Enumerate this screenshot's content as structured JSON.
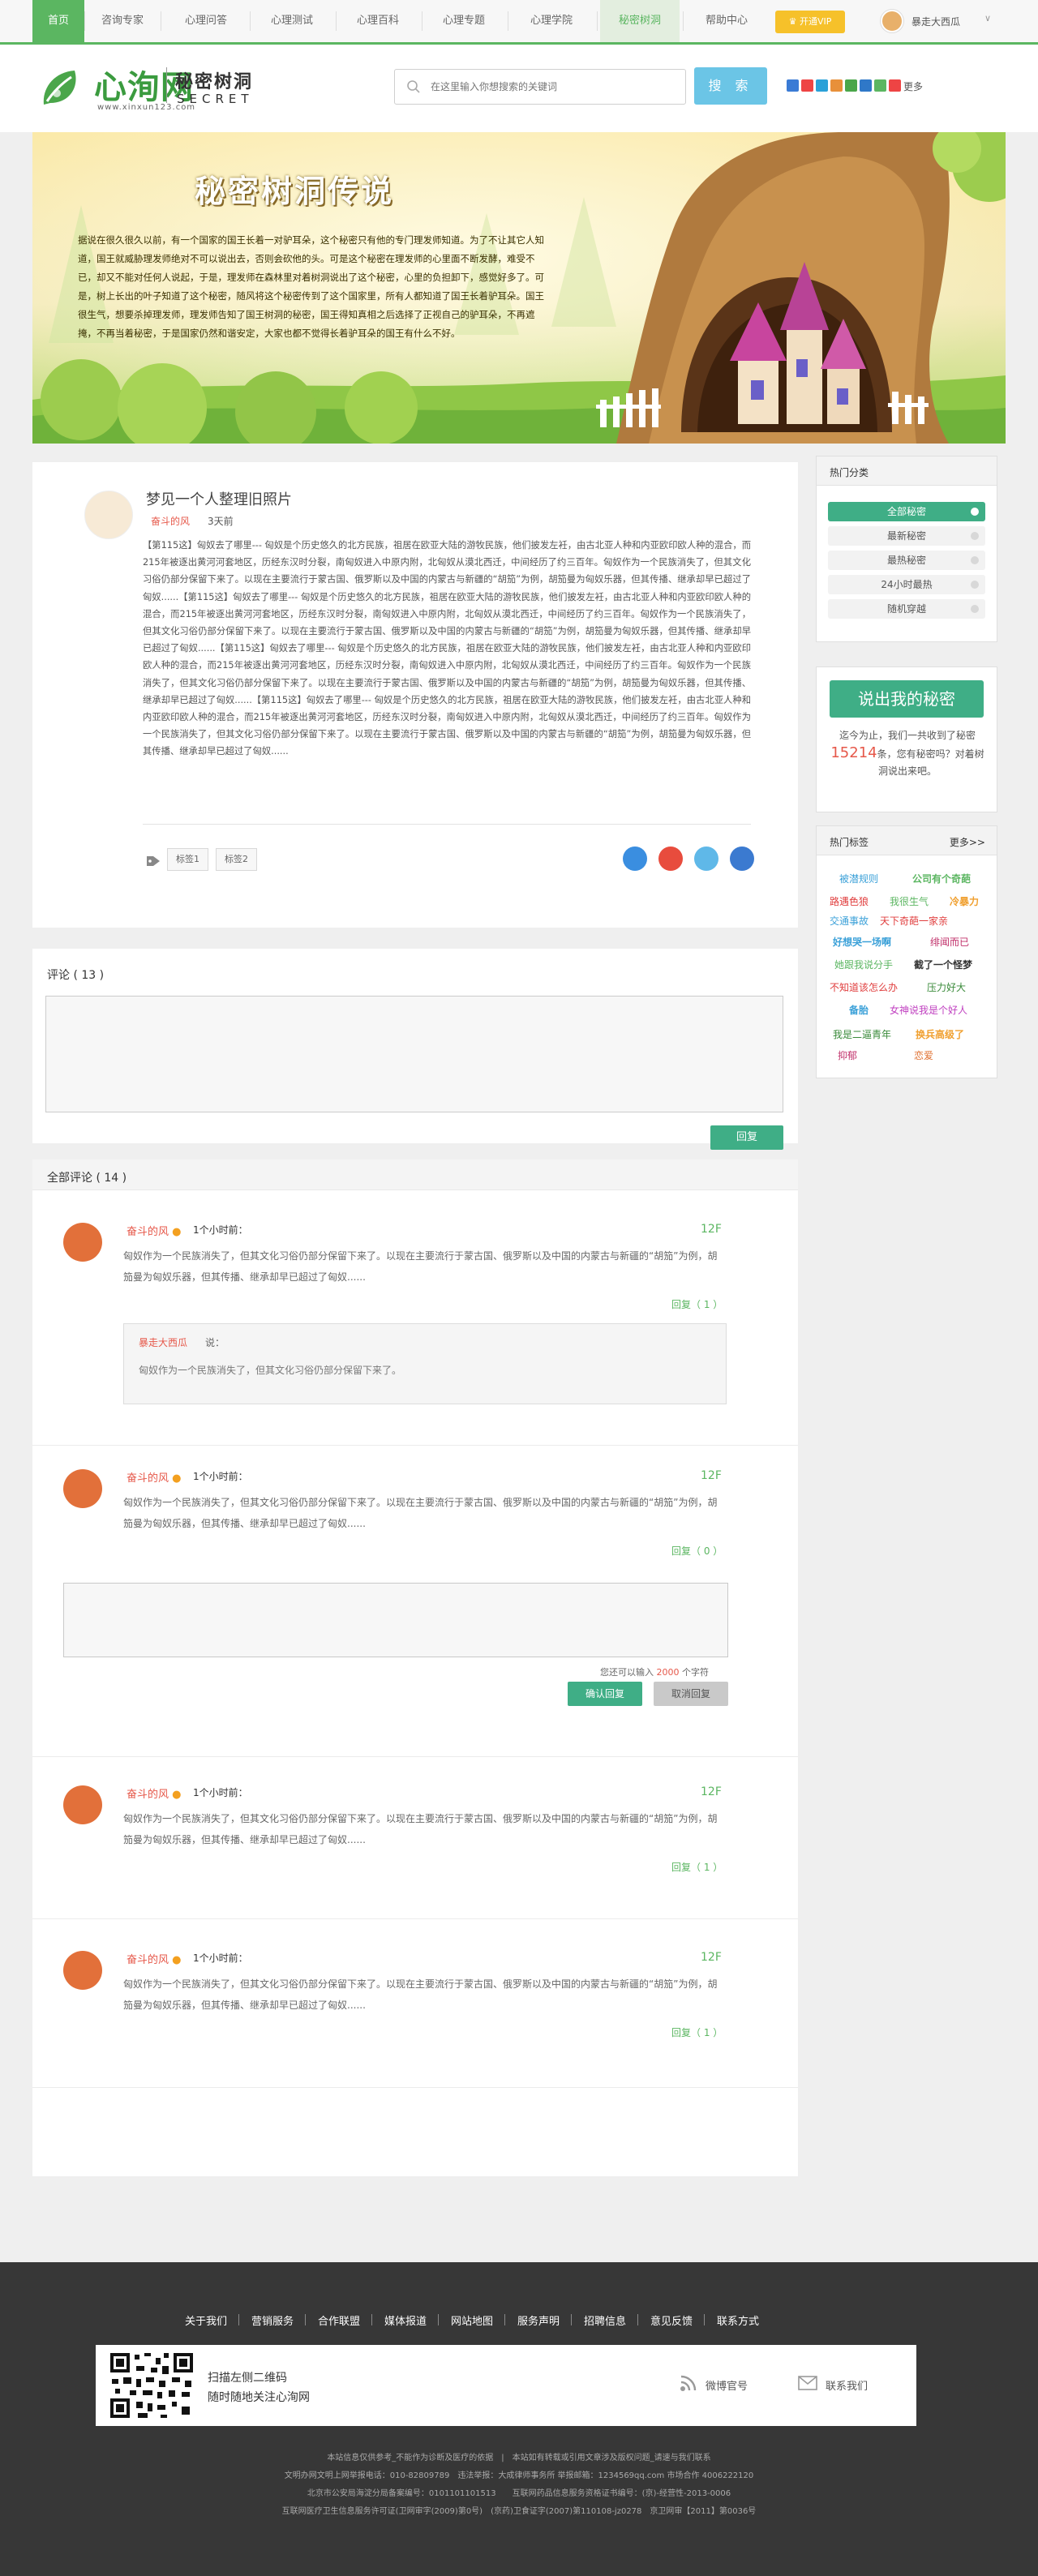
{
  "nav": {
    "items": [
      {
        "label": "首页"
      },
      {
        "label": "咨询专家"
      },
      {
        "label": "心理问答"
      },
      {
        "label": "心理测试"
      },
      {
        "label": "心理百科"
      },
      {
        "label": "心理专题"
      },
      {
        "label": "心理学院"
      },
      {
        "label": "秘密树洞"
      },
      {
        "label": "帮助中心"
      }
    ],
    "open_btn": "开通VIP",
    "user_name": "暴走大西瓜",
    "user_caret": "∨"
  },
  "header": {
    "logo_name": "心洵网",
    "logo_url": "www.xinxun123.com",
    "logo_sub_cn": "秘密树洞",
    "logo_sub_en": "SECRET",
    "search_placeholder": "在这里输入你想搜索的关键词",
    "search_btn": "搜 索",
    "share_more": "更多"
  },
  "banner": {
    "title": "秘密树洞传说",
    "text": "据说在很久很久以前，有一个国家的国王长着一对驴耳朵，这个秘密只有他的专门理发师知道。为了不让其它人知道，国王就威胁理发师绝对不可以说出去，否则会砍他的头。可是这个秘密在理发师的心里面不断发酵，难受不已，却又不能对任何人说起，于是，理发师在森林里对着树洞说出了这个秘密，心里的负担卸下，感觉好多了。可是，树上长出的叶子知道了这个秘密，随风将这个秘密传到了这个国家里，所有人都知道了国王长着驴耳朵。国王很生气，想要杀掉理发师，理发师告知了国王树洞的秘密，国王得知真相之后选择了正视自己的驴耳朵，不再遮掩，不再当着秘密，于是国家仍然和谐安定，大家也都不觉得长着驴耳朵的国王有什么不好。"
  },
  "article": {
    "title": "梦见一个人整理旧照片",
    "author": "奋斗的风",
    "time": "3天前",
    "body": "【第115这】匈奴去了哪里--- 匈奴是个历史悠久的北方民族，祖居在欧亚大陆的游牧民族，他们披发左衽，由古北亚人种和内亚欧印欧人种的混合，而215年被逐出黄河河套地区，历经东汉时分裂，南匈奴进入中原内附，北匈奴从漠北西迁，中间经历了约三百年。匈奴作为一个民族消失了，但其文化习俗仍部分保留下来了。以现在主要流行于蒙古国、俄罗斯以及中国的内蒙古与新疆的“胡笳”为例，胡笳曼为匈奴乐器，但其传播、继承却早已超过了匈奴......【第115这】匈奴去了哪里--- 匈奴是个历史悠久的北方民族，祖居在欧亚大陆的游牧民族，他们披发左衽，由古北亚人种和内亚欧印欧人种的混合，而215年被逐出黄河河套地区，历经东汉时分裂，南匈奴进入中原内附，北匈奴从漠北西迁，中间经历了约三百年。匈奴作为一个民族消失了，但其文化习俗仍部分保留下来了。以现在主要流行于蒙古国、俄罗斯以及中国的内蒙古与新疆的“胡笳”为例，胡笳曼为匈奴乐器，但其传播、继承却早已超过了匈奴......【第115这】匈奴去了哪里--- 匈奴是个历史悠久的北方民族，祖居在欧亚大陆的游牧民族，他们披发左衽，由古北亚人种和内亚欧印欧人种的混合，而215年被逐出黄河河套地区，历经东汉时分裂，南匈奴进入中原内附，北匈奴从漠北西迁，中间经历了约三百年。匈奴作为一个民族消失了，但其文化习俗仍部分保留下来了。以现在主要流行于蒙古国、俄罗斯以及中国的内蒙古与新疆的“胡笳”为例，胡笳曼为匈奴乐器，但其传播、继承却早已超过了匈奴......【第115这】匈奴去了哪里--- 匈奴是个历史悠久的北方民族，祖居在欧亚大陆的游牧民族，他们披发左衽，由古北亚人种和内亚欧印欧人种的混合，而215年被逐出黄河河套地区，历经东汉时分裂，南匈奴进入中原内附，北匈奴从漠北西迁，中间经历了约三百年。匈奴作为一个民族消失了，但其文化习俗仍部分保留下来了。以现在主要流行于蒙古国、俄罗斯以及中国的内蒙古与新疆的“胡笳”为例，胡笳曼为匈奴乐器，但其传播、继承却早已超过了匈奴......",
    "tags": [
      "标签1",
      "标签2"
    ]
  },
  "comment_box": {
    "title": "评论 ( 13 )",
    "reply_btn": "回复"
  },
  "all_comments": {
    "title": "全部评论 ( 14 )",
    "items": [
      {
        "author": "奋斗的风",
        "time": "1个小时前：",
        "floor": "12F",
        "text": "匈奴作为一个民族消失了，但其文化习俗仍部分保留下来了。以现在主要流行于蒙古国、俄罗斯以及中国的内蒙古与新疆的“胡笳”为例，胡笳曼为匈奴乐器，但其传播、继承却早已超过了匈奴......",
        "reply": "回复（ 1 ）",
        "nested_author": "暴走大西瓜",
        "nested_suffix": "说：",
        "nested_text": "匈奴作为一个民族消失了，但其文化习俗仍部分保留下来了。"
      },
      {
        "author": "奋斗的风",
        "time": "1个小时前：",
        "floor": "12F",
        "text": "匈奴作为一个民族消失了，但其文化习俗仍部分保留下来了。以现在主要流行于蒙古国、俄罗斯以及中国的内蒙古与新疆的“胡笳”为例，胡笳曼为匈奴乐器，但其传播、继承却早已超过了匈奴......",
        "reply": "回复（ 0 ）",
        "counter_prefix": "您还可以输入",
        "counter_num": "2000",
        "counter_suffix": "个字符",
        "confirm": "确认回复",
        "cancel": "取消回复"
      },
      {
        "author": "奋斗的风",
        "time": "1个小时前：",
        "floor": "12F",
        "text": "匈奴作为一个民族消失了，但其文化习俗仍部分保留下来了。以现在主要流行于蒙古国、俄罗斯以及中国的内蒙古与新疆的“胡笳”为例，胡笳曼为匈奴乐器，但其传播、继承却早已超过了匈奴......",
        "reply": "回复（ 1 ）"
      },
      {
        "author": "奋斗的风",
        "time": "1个小时前：",
        "floor": "12F",
        "text": "匈奴作为一个民族消失了，但其文化习俗仍部分保留下来了。以现在主要流行于蒙古国、俄罗斯以及中国的内蒙古与新疆的“胡笳”为例，胡笳曼为匈奴乐器，但其传播、继承却早已超过了匈奴......",
        "reply": "回复（ 1 ）"
      }
    ]
  },
  "sidebar": {
    "categories": {
      "title": "热门分类",
      "items": [
        "全部秘密",
        "最新秘密",
        "最热秘密",
        "24小时最热",
        "随机穿越"
      ]
    },
    "say": {
      "button": "说出我的秘密",
      "text_prefix": "迄今为止，我们一共收到了秘密",
      "count": "15214",
      "text_suffix": "条，您有秘密吗？对着树洞说出来吧。"
    },
    "tags": {
      "title": "热门标签",
      "more": "更多>>",
      "items": [
        {
          "label": "被潜规则",
          "color": "#3aa0d8"
        },
        {
          "label": "公司有个奇葩",
          "color": "#5bb661"
        },
        {
          "label": "路遇色狼",
          "color": "#e03d3d"
        },
        {
          "label": "我很生气",
          "color": "#5bb661"
        },
        {
          "label": "冷暴力",
          "color": "#f0a030"
        },
        {
          "label": "交通事故",
          "color": "#3aa0d8"
        },
        {
          "label": "天下奇葩一家亲",
          "color": "#e03d3d"
        },
        {
          "label": "好想哭一场啊",
          "color": "#3aa0d8"
        },
        {
          "label": "绯闻而已",
          "color": "#c0306a"
        },
        {
          "label": "她跟我说分手",
          "color": "#5bb661"
        },
        {
          "label": "截了一个怪梦",
          "color": "#333333"
        },
        {
          "label": "不知道该怎么办",
          "color": "#e03d3d"
        },
        {
          "label": "压力好大",
          "color": "#3a8a3a"
        },
        {
          "label": "备胎",
          "color": "#3aa0d8"
        },
        {
          "label": "女神说我是个好人",
          "color": "#c040c0"
        },
        {
          "label": "我是二逼青年",
          "color": "#3a8a3a"
        },
        {
          "label": "换兵高级了",
          "color": "#f0a030"
        },
        {
          "label": "抑郁",
          "color": "#c0306a"
        },
        {
          "label": "恋爱",
          "color": "#e07030"
        }
      ]
    }
  },
  "footer": {
    "links": [
      "关于我们",
      "营销服务",
      "合作联盟",
      "媒体报道",
      "网站地图",
      "服务声明",
      "招聘信息",
      "意见反馈",
      "联系方式"
    ],
    "scan1": "扫描左侧二维码",
    "scan2": "随时随地关注心洵网",
    "weibo": "微博官号",
    "contact": "联系我们",
    "lines": [
      "本站信息仅供参考_不能作为诊断及医疗的依据　|　本站如有转载或引用文章涉及版权问题_请速与我们联系",
      "文明办网文明上网举报电话：010-82809789　违法举报：大成律师事务所 举报邮箱：1234569qq.com 市场合作 4006222120",
      "北京市公安局海淀分局备案编号：0101101101513　　互联网药品信息服务资格证书编号：(京)-经营性-2013-0006",
      "互联网医疗卫生信息服务许可证(卫网审字(2009)第0号)　(京药)卫食证字(2007)第110108-jz0278　京卫网审【2011】第0036号"
    ]
  }
}
